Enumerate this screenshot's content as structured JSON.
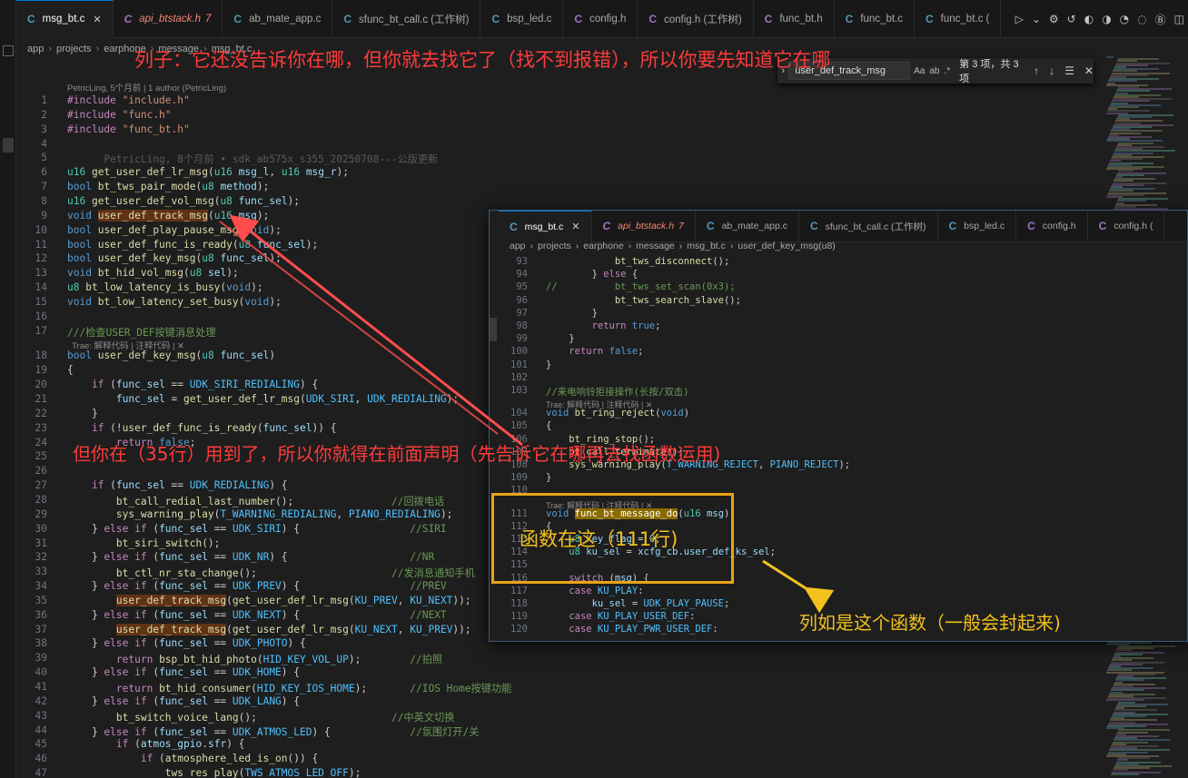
{
  "tabs": [
    {
      "label": "msg_bt.c",
      "kind": "c",
      "active": true
    },
    {
      "label": "api_btstack.h",
      "kind": "h",
      "error_count": "7"
    },
    {
      "label": "ab_mate_app.c",
      "kind": "c"
    },
    {
      "label": "sfunc_bt_call.c (工作树)",
      "kind": "c"
    },
    {
      "label": "bsp_led.c",
      "kind": "c"
    },
    {
      "label": "config.h",
      "kind": "h"
    },
    {
      "label": "config.h (工作树)",
      "kind": "h"
    },
    {
      "label": "func_bt.h",
      "kind": "h"
    },
    {
      "label": "func_bt.c",
      "kind": "c"
    },
    {
      "label": "func_bt.c (",
      "kind": "c"
    }
  ],
  "breadcrumb": [
    "app",
    "projects",
    "earphone",
    "message",
    "msg_bt.c"
  ],
  "find": {
    "query": "user_def_track_msg",
    "result": "第 3 项，共 3 项",
    "opt_case": "Aa",
    "opt_word": "ab",
    "opt_regex": ".*"
  },
  "codelens_top": "PetricLing, 5个月前 | 1 author (PetricLing)",
  "blame_line6": "PetricLing, 8个月前 • sdk_ab575x_s355_20250708---公版更新",
  "trae_lens": "Trae: 解释代码 | 注释代码 | ✕",
  "main_lines": [
    {
      "n": "1",
      "html": "<span class='pp'>#include</span> <span class='st'>\"include.h\"</span>"
    },
    {
      "n": "2",
      "html": "<span class='pp'>#include</span> <span class='st'>\"func.h\"</span>"
    },
    {
      "n": "3",
      "html": "<span class='pp'>#include</span> <span class='st'>\"func_bt.h\"</span>"
    },
    {
      "n": "4",
      "html": ""
    },
    {
      "n": "5",
      "html": ""
    },
    {
      "n": "6",
      "html": "<span class='ty'>u16</span> <span class='fn'>get_user_def_lr_msg</span>(<span class='ty'>u16</span> <span class='id'>msg_l</span>, <span class='ty'>u16</span> <span class='id'>msg_r</span>);"
    },
    {
      "n": "7",
      "html": "<span class='kw'>bool</span> <span class='fn'>bt_tws_pair_mode</span>(<span class='ty'>u8</span> <span class='id'>method</span>);"
    },
    {
      "n": "8",
      "html": "<span class='ty'>u16</span> <span class='fn'>get_user_def_vol_msg</span>(<span class='ty'>u8</span> <span class='id'>func_sel</span>);"
    },
    {
      "n": "9",
      "html": "<span class='kw'>void</span> <span class='fn hl'>user_def_track_msg</span>(<span class='ty'>u16</span> <span class='id'>msg</span>);"
    },
    {
      "n": "10",
      "html": "<span class='kw'>bool</span> <span class='fn'>user_def_play_pause_msg</span>(<span class='kw'>void</span>);"
    },
    {
      "n": "11",
      "html": "<span class='kw'>bool</span> <span class='fn'>user_def_func_is_ready</span>(<span class='ty'>u8</span> <span class='id'>func_sel</span>);"
    },
    {
      "n": "12",
      "html": "<span class='kw'>bool</span> <span class='fn'>user_def_key_msg</span>(<span class='ty'>u8</span> <span class='id'>func_sel</span>);"
    },
    {
      "n": "13",
      "html": "<span class='kw'>void</span> <span class='fn'>bt_hid_vol_msg</span>(<span class='ty'>u8</span> <span class='id'>sel</span>);"
    },
    {
      "n": "14",
      "html": "<span class='ty'>u8</span> <span class='fn'>bt_low_latency_is_busy</span>(<span class='kw'>void</span>);"
    },
    {
      "n": "15",
      "html": "<span class='kw'>void</span> <span class='fn'>bt_low_latency_set_busy</span>(<span class='kw'>void</span>);"
    },
    {
      "n": "16",
      "html": ""
    },
    {
      "n": "17",
      "html": "<span class='cm'>///检查USER_DEF按键消息处理</span>"
    },
    {
      "n": "18",
      "html": "<span class='kw'>bool</span> <span class='fn'>user_def_key_msg</span>(<span class='ty'>u8</span> <span class='id'>func_sel</span>)"
    },
    {
      "n": "19",
      "html": "{"
    },
    {
      "n": "20",
      "html": "    <span class='pp'>if</span> (<span class='id'>func_sel</span> == <span class='mc'>UDK_SIRI_REDIALING</span>) {"
    },
    {
      "n": "21",
      "html": "        <span class='id'>func_sel</span> = <span class='fn'>get_user_def_lr_msg</span>(<span class='mc'>UDK_SIRI</span>, <span class='mc'>UDK_REDIALING</span>);"
    },
    {
      "n": "22",
      "html": "    }"
    },
    {
      "n": "23",
      "html": "    <span class='pp'>if</span> (!<span class='fn'>user_def_func_is_ready</span>(<span class='id'>func_sel</span>)) {"
    },
    {
      "n": "24",
      "html": "        <span class='pp'>return</span> <span class='kw'>false</span>;"
    },
    {
      "n": "25",
      "html": ""
    },
    {
      "n": "26",
      "html": ""
    },
    {
      "n": "27",
      "html": "    <span class='pp'>if</span> (<span class='id'>func_sel</span> == <span class='mc'>UDK_REDIALING</span>) {"
    },
    {
      "n": "28",
      "html": "        <span class='fn'>bt_call_redial_last_number</span>();                <span class='cm'>//回拨电话</span>"
    },
    {
      "n": "29",
      "html": "        <span class='fn'>sys_warning_play</span>(<span class='mc'>T_WARNING_REDIALING</span>, <span class='mc'>PIANO_REDIALING</span>);"
    },
    {
      "n": "30",
      "html": "    } <span class='pp'>else if</span> (<span class='id'>func_sel</span> == <span class='mc'>UDK_SIRI</span>) {                  <span class='cm'>//SIRI</span>"
    },
    {
      "n": "31",
      "html": "        <span class='fn'>bt_siri_switch</span>();"
    },
    {
      "n": "32",
      "html": "    } <span class='pp'>else if</span> (<span class='id'>func_sel</span> == <span class='mc'>UDK_NR</span>) {                    <span class='cm'>//NR</span>"
    },
    {
      "n": "33",
      "html": "        <span class='fn'>bt_ctl_nr_sta_change</span>();                      <span class='cm'>//发消息通知手机</span>"
    },
    {
      "n": "34",
      "html": "    } <span class='pp'>else if</span> (<span class='id'>func_sel</span> == <span class='mc'>UDK_PREV</span>) {                  <span class='cm'>//PREV</span>"
    },
    {
      "n": "35",
      "html": "        <span class='fn hl'>user_def_track_msg</span>(<span class='fn'>get_user_def_lr_msg</span>(<span class='mc'>KU_PREV</span>, <span class='mc'>KU_NEXT</span>));"
    },
    {
      "n": "36",
      "html": "    } <span class='pp'>else if</span> (<span class='id'>func_sel</span> == <span class='mc'>UDK_NEXT</span>) {                  <span class='cm'>//NEXT</span>"
    },
    {
      "n": "37",
      "html": "        <span class='fn hl'>user_def_track_msg</span>(<span class='fn'>get_user_def_lr_msg</span>(<span class='mc'>KU_NEXT</span>, <span class='mc'>KU_PREV</span>));"
    },
    {
      "n": "38",
      "html": "    } <span class='pp'>else if</span> (<span class='id'>func_sel</span> == <span class='mc'>UDK_PHOTO</span>) {"
    },
    {
      "n": "39",
      "html": "        <span class='pp'>return</span> <span class='fn'>bsp_bt_hid_photo</span>(<span class='mc'>HID_KEY_VOL_UP</span>);        <span class='cm'>//拍照</span>"
    },
    {
      "n": "40",
      "html": "    } <span class='pp'>else if</span> (<span class='id'>func_sel</span> == <span class='mc'>UDK_HOME</span>) {"
    },
    {
      "n": "41",
      "html": "        <span class='pp'>return</span> <span class='fn'>bt_hid_consumer</span>(<span class='mc'>HID_KEY_IOS_HOME</span>);       <span class='cm'>//IOS Home按键功能</span>"
    },
    {
      "n": "42",
      "html": "    } <span class='pp'>else if</span> (<span class='id'>func_sel</span> == <span class='mc'>UDK_LANG</span>) {"
    },
    {
      "n": "43",
      "html": "        <span class='fn'>bt_switch_voice_lang</span>();                      <span class='cm'>//中英文切换</span>"
    },
    {
      "n": "44",
      "html": "    } <span class='pp'>else if</span> (<span class='id'>func_sel</span> == <span class='mc'>UDK_ATMOS_LED</span>) {             <span class='cm'>//氛围灯开/关</span>"
    },
    {
      "n": "45",
      "html": "        <span class='pp'>if</span> (<span class='id'>atmos_gpio</span>.<span class='id'>sfr</span>) {"
    },
    {
      "n": "46",
      "html": "            <span class='pp'>if</span> (<span class='fn'>atmosphere_led_is_on</span>()) {"
    },
    {
      "n": "47",
      "html": "                <span class='fn'>tws_res_play</span>(<span class='mc'>TWS_ATMOS_LED_OFF</span>);"
    }
  ],
  "overlay": {
    "tabs": [
      {
        "label": "msg_bt.c",
        "kind": "c",
        "active": true
      },
      {
        "label": "api_btstack.h",
        "kind": "h",
        "error_count": "7"
      },
      {
        "label": "ab_mate_app.c",
        "kind": "c"
      },
      {
        "label": "sfunc_bt_call.c (工作树)",
        "kind": "c"
      },
      {
        "label": "bsp_led.c",
        "kind": "c"
      },
      {
        "label": "config.h",
        "kind": "h"
      },
      {
        "label": "config.h (",
        "kind": "h"
      }
    ],
    "breadcrumb": [
      "app",
      "projects",
      "earphone",
      "message",
      "msg_bt.c",
      "user_def_key_msg(u8)"
    ],
    "lines": [
      {
        "n": "93",
        "html": "            <span class='fn'>bt_tws_disconnect</span>();"
      },
      {
        "n": "94",
        "html": "        } <span class='pp'>else</span> {"
      },
      {
        "n": "95",
        "html": "<span class='cm'>//          bt_tws_set_scan(0x3);</span>"
      },
      {
        "n": "96",
        "html": "            <span class='fn'>bt_tws_search_slave</span>();"
      },
      {
        "n": "97",
        "html": "        }"
      },
      {
        "n": "98",
        "html": "        <span class='pp'>return</span> <span class='kw'>true</span>;"
      },
      {
        "n": "99",
        "html": "    }"
      },
      {
        "n": "100",
        "html": "    <span class='pp'>return</span> <span class='kw'>false</span>;"
      },
      {
        "n": "101",
        "html": "}"
      },
      {
        "n": "102",
        "html": ""
      },
      {
        "n": "103",
        "html": "<span class='cm'>//来电响铃拒接操作(长按/双击)</span>"
      },
      {
        "n": "104",
        "html": "<span class='kw'>void</span> <span class='fn'>bt_ring_reject</span>(<span class='kw'>void</span>)"
      },
      {
        "n": "105",
        "html": "{"
      },
      {
        "n": "106",
        "html": "    <span class='fn'>bt_ring_stop</span>();"
      },
      {
        "n": "107",
        "html": "    <span class='fn'>bt_call_terminate</span>();"
      },
      {
        "n": "108",
        "html": "    <span class='fn'>sys_warning_play</span>(<span class='mc'>T_WARNING_REJECT</span>, <span class='mc'>PIANO_REJECT</span>);"
      },
      {
        "n": "109",
        "html": "}"
      },
      {
        "n": "110",
        "html": ""
      },
      {
        "n": "111",
        "html": "<span class='kw'>void</span> <span class='fn hl2'>func_bt_message_do</span>(<span class='ty'>u16</span> <span class='id'>msg</span>)"
      },
      {
        "n": "112",
        "html": "{"
      },
      {
        "n": "113",
        "html": "    <span class='ty'>u8</span> <span class='id'>key_flag</span> = <span class='nm'>0</span>;"
      },
      {
        "n": "114",
        "html": "    <span class='ty'>u8</span> <span class='id'>ku_sel</span> = <span class='id'>xcfg_cb</span>.<span class='id'>user_def_ks_sel</span>;"
      },
      {
        "n": "115",
        "html": ""
      },
      {
        "n": "116",
        "html": "    <span class='pp'>switch</span> (<span class='id'>msg</span>) {"
      },
      {
        "n": "117",
        "html": "    <span class='pp'>case</span> <span class='mc'>KU_PLAY</span>:"
      },
      {
        "n": "118",
        "html": "        <span class='id'>ku_sel</span> = <span class='mc'>UDK_PLAY_PAUSE</span>;"
      },
      {
        "n": "119",
        "html": "    <span class='pp'>case</span> <span class='mc'>KU_PLAY_USER_DEF</span>:"
      },
      {
        "n": "120",
        "html": "    <span class='pp'>case</span> <span class='mc'>KU_PLAY_PWR_USER_DEF</span>:"
      }
    ]
  },
  "annotations": {
    "top": "列子：它还没告诉你在哪，但你就去找它了（找不到报错），所以你要先知道它在哪",
    "middle": "但你在（35行）用到了，所以你就得在前面声明（先告诉它在哪再去找函数运用)",
    "box": "函数在这（111行)",
    "right": "列如是这个函数（一般会封起来)"
  },
  "colors": {
    "annotation_red": "#ff3b3b",
    "annotation_yellow": "#f2c11c",
    "box_border": "#e8a317",
    "tab_accent": "#0078d4"
  }
}
